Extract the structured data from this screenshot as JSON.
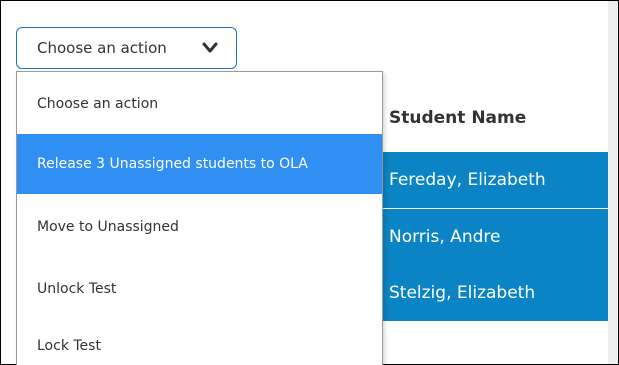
{
  "action_select": {
    "selected_label": "Choose an action",
    "chevron_icon": "chevron-down-icon"
  },
  "menu": {
    "items": [
      {
        "label": "Choose an action",
        "highlighted": false
      },
      {
        "label": "Release 3 Unassigned students to OLA",
        "highlighted": true
      },
      {
        "label": "Move to Unassigned",
        "highlighted": false
      },
      {
        "label": "Unlock Test",
        "highlighted": false
      },
      {
        "label": "Lock Test",
        "highlighted": false
      }
    ],
    "highlight_color": "#2f8ff3"
  },
  "table": {
    "header_student_name": "Student Name",
    "rows": [
      {
        "student_name": "Fereday, Elizabeth",
        "selected": true
      },
      {
        "student_name": "Norris, Andre",
        "selected": true
      },
      {
        "student_name": "Stelzig, Elizabeth",
        "selected": true
      }
    ],
    "selected_row_color": "#0a84c4"
  }
}
